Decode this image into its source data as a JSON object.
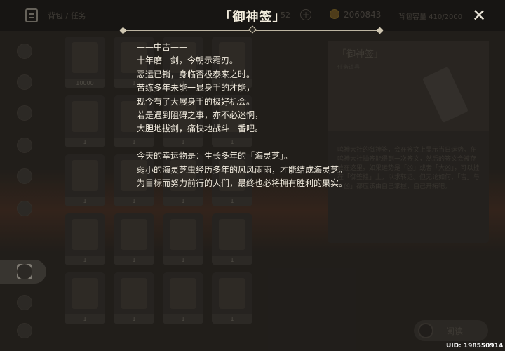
{
  "background": {
    "breadcrumb": "背包 / 任务",
    "count_fragment": "52",
    "mora": "2060843",
    "capacity": "背包容量 410/2000",
    "slots": [
      {
        "count": "10000"
      },
      {
        "count": "1"
      },
      {
        "count": "1"
      },
      {
        "count": "1"
      },
      {
        "count": "1"
      },
      {
        "count": "1"
      },
      {
        "count": "1"
      },
      {
        "count": "1"
      },
      {
        "count": "1"
      },
      {
        "count": "1"
      },
      {
        "count": "1"
      },
      {
        "count": "1"
      },
      {
        "count": "1"
      },
      {
        "count": "1"
      },
      {
        "count": "1"
      },
      {
        "count": "1"
      },
      {
        "count": "1"
      },
      {
        "count": "1"
      },
      {
        "count": "1"
      },
      {
        "count": "1"
      }
    ],
    "detail": {
      "title": "「御神签」",
      "subtitle": "任务道具",
      "description": "鸣神大社的御神签，会在签文上显示当日运势。在鸣神大社抽签能得到一次签文，然后的签文会被存放在这里。如果运势是「凶」或者「大凶」，可以挂在「御签挂」上，以求转运。但无论如何，「吉」与「凶」都应该由自己掌握，自己开拓吧。"
    },
    "read_button": "阅读"
  },
  "modal": {
    "title": "「御神签」",
    "lines": [
      "——中吉——",
      "十年磨一剑，今朝示霜刃。",
      "恶运已销，身临否极泰来之时。",
      "苦练多年未能一显身手的才能，",
      "现今有了大展身手的极好机会。",
      "若是遇到阻碍之事，亦不必迷惘，",
      "大胆地拔剑，痛快地战斗一番吧。",
      "",
      "今天的幸运物是：生长多年的「海灵芝」。",
      "弱小的海灵芝虫经历多年的风风雨雨，才能结成海灵芝。",
      "为目标而努力前行的人们，最终也必将拥有胜利的果实。"
    ],
    "close_icon": "close-icon"
  },
  "uid": "UID: 198550914"
}
